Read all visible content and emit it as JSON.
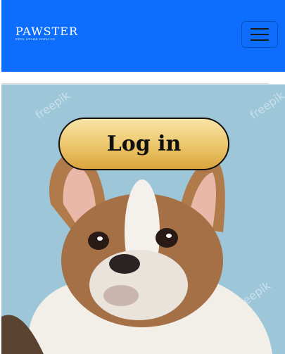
{
  "brand": {
    "name": "PAWSTER",
    "tagline": "PETS STORE WITH US"
  },
  "login_button": {
    "label": "Log in"
  },
  "hero": {
    "watermark": "freepik"
  },
  "colors": {
    "navbar": "#0d6efd",
    "button_gold": "#ecc66a"
  }
}
